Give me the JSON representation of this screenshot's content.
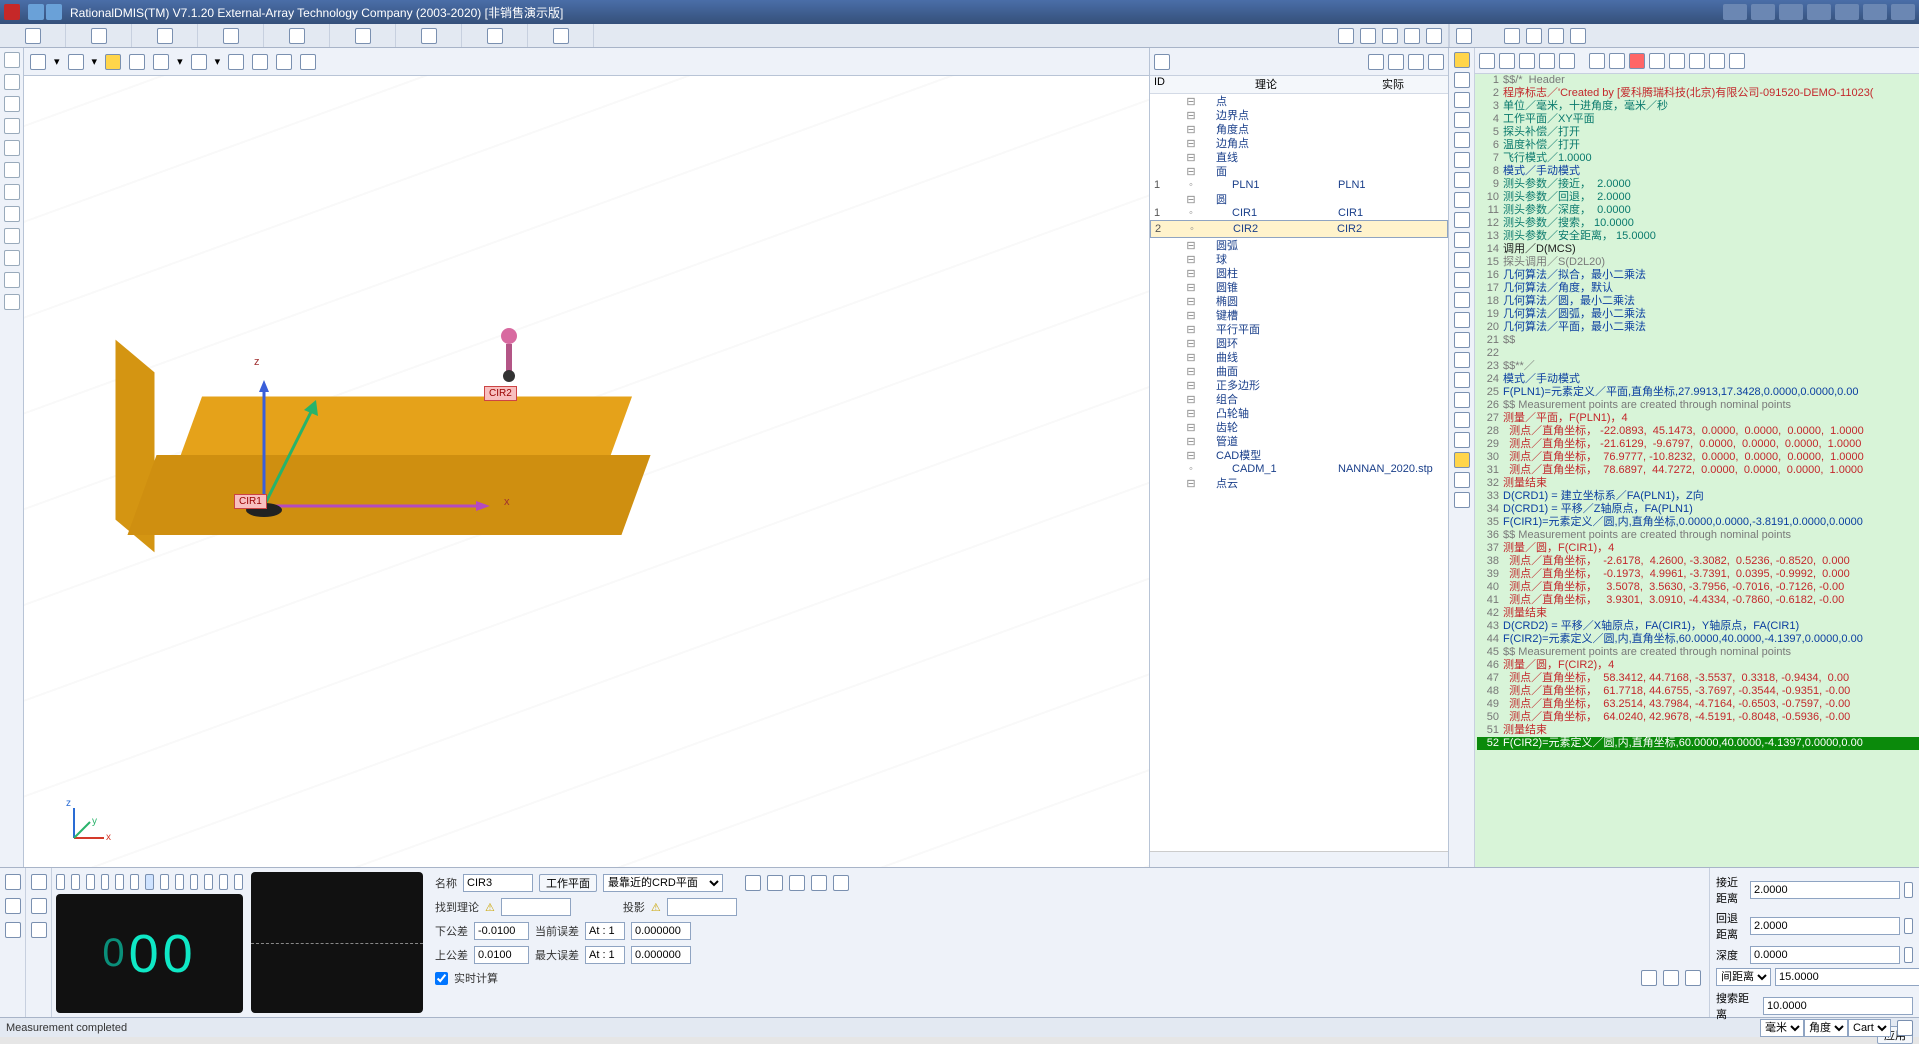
{
  "title": "RationalDMIS(TM) V7.1.20    External-Array Technology Company (2003-2020) [非销售演示版]",
  "ribbon_icons": [
    "open",
    "doc",
    "grid",
    "cube",
    "gem",
    "flask",
    "cloud",
    "gear",
    "window",
    "cube2",
    "shapes",
    "wrench",
    "target",
    "camera"
  ],
  "view_toolbar": [
    "home",
    "arrow",
    "refresh",
    "zoom",
    "axes",
    "eye",
    "layers",
    "print",
    "snapshot",
    "run"
  ],
  "view3d": {
    "x_axis": "x",
    "y_axis": "y",
    "z_axis": "z",
    "tag1": "CIR1",
    "tag2": "CIR2",
    "corner_x": "x",
    "corner_y": "y",
    "corner_z": "z"
  },
  "mid": {
    "col_id": "ID",
    "col_theory": "理论",
    "col_actual": "实际",
    "tree": [
      {
        "d": 1,
        "l": "点"
      },
      {
        "d": 1,
        "l": "边界点"
      },
      {
        "d": 1,
        "l": "角度点"
      },
      {
        "d": 1,
        "l": "边角点"
      },
      {
        "d": 1,
        "l": "直线"
      },
      {
        "d": 1,
        "l": "面"
      },
      {
        "d": 2,
        "id": "1",
        "l": "PLN1",
        "a": "PLN1"
      },
      {
        "d": 1,
        "l": "圆"
      },
      {
        "d": 2,
        "id": "1",
        "l": "CIR1",
        "a": "CIR1"
      },
      {
        "d": 2,
        "id": "2",
        "l": "CIR2",
        "a": "CIR2",
        "sel": true
      },
      {
        "d": 1,
        "l": "圆弧"
      },
      {
        "d": 1,
        "l": "球"
      },
      {
        "d": 1,
        "l": "圆柱"
      },
      {
        "d": 1,
        "l": "圆锥"
      },
      {
        "d": 1,
        "l": "椭圆"
      },
      {
        "d": 1,
        "l": "键槽"
      },
      {
        "d": 1,
        "l": "平行平面"
      },
      {
        "d": 1,
        "l": "圆环"
      },
      {
        "d": 1,
        "l": "曲线"
      },
      {
        "d": 1,
        "l": "曲面"
      },
      {
        "d": 1,
        "l": "正多边形"
      },
      {
        "d": 1,
        "l": "组合"
      },
      {
        "d": 1,
        "l": "凸轮轴"
      },
      {
        "d": 1,
        "l": "齿轮"
      },
      {
        "d": 1,
        "l": "管道"
      },
      {
        "d": 1,
        "l": "CAD模型"
      },
      {
        "d": 2,
        "l": "CADM_1",
        "a": "NANNAN_2020.stp"
      },
      {
        "d": 1,
        "l": "点云"
      }
    ]
  },
  "code": [
    {
      "n": 1,
      "t": "$$/*  Header",
      "c": "gray"
    },
    {
      "n": 2,
      "t": "程序标志／'Created by [爱科腾瑞科技(北京)有限公司-091520-DEMO-11023(",
      "c": "red"
    },
    {
      "n": 3,
      "t": "单位／毫米，十进角度，毫米／秒",
      "c": "teal"
    },
    {
      "n": 4,
      "t": "工作平面／XY平面",
      "c": "teal"
    },
    {
      "n": 5,
      "t": "探头补偿／打开",
      "c": "teal"
    },
    {
      "n": 6,
      "t": "温度补偿／打开",
      "c": "teal"
    },
    {
      "n": 7,
      "t": "飞行模式／1.0000",
      "c": "teal"
    },
    {
      "n": 8,
      "t": "模式／手动模式",
      "c": "blue"
    },
    {
      "n": 9,
      "t": "测头参数／接近，  2.0000",
      "c": "teal"
    },
    {
      "n": 10,
      "t": "测头参数／回退，  2.0000",
      "c": "teal"
    },
    {
      "n": 11,
      "t": "测头参数／深度，  0.0000",
      "c": "teal"
    },
    {
      "n": 12,
      "t": "测头参数／搜索， 10.0000",
      "c": "teal"
    },
    {
      "n": 13,
      "t": "测头参数／安全距离， 15.0000",
      "c": "teal"
    },
    {
      "n": 14,
      "t": "调用／D(MCS)",
      "c": "dk"
    },
    {
      "n": 15,
      "t": "探头调用／S(D2L20)",
      "c": "gray"
    },
    {
      "n": 16,
      "t": "几何算法／拟合，最小二乘法",
      "c": "blue"
    },
    {
      "n": 17,
      "t": "几何算法／角度，默认",
      "c": "blue"
    },
    {
      "n": 18,
      "t": "几何算法／圆，最小二乘法",
      "c": "blue"
    },
    {
      "n": 19,
      "t": "几何算法／圆弧，最小二乘法",
      "c": "blue"
    },
    {
      "n": 20,
      "t": "几何算法／平面，最小二乘法",
      "c": "blue"
    },
    {
      "n": 21,
      "t": "$$",
      "c": "gray"
    },
    {
      "n": 22,
      "t": "",
      "c": "gray"
    },
    {
      "n": 23,
      "t": "$$**／",
      "c": "gray"
    },
    {
      "n": 24,
      "t": "模式／手动模式",
      "c": "blue"
    },
    {
      "n": 25,
      "t": "F(PLN1)=元素定义／平面,直角坐标,27.9913,17.3428,0.0000,0.0000,0.00",
      "c": "blue"
    },
    {
      "n": 26,
      "t": "$$ Measurement points are created through nominal points",
      "c": "gray"
    },
    {
      "n": 27,
      "t": "测量／平面，F(PLN1)，4",
      "c": "red"
    },
    {
      "n": 28,
      "t": "  测点／直角坐标， -22.0893,  45.1473,  0.0000,  0.0000,  0.0000,  1.0000",
      "c": "red"
    },
    {
      "n": 29,
      "t": "  测点／直角坐标， -21.6129,  -9.6797,  0.0000,  0.0000,  0.0000,  1.0000",
      "c": "red"
    },
    {
      "n": 30,
      "t": "  测点／直角坐标，  76.9777, -10.8232,  0.0000,  0.0000,  0.0000,  1.0000",
      "c": "red"
    },
    {
      "n": 31,
      "t": "  测点／直角坐标，  78.6897,  44.7272,  0.0000,  0.0000,  0.0000,  1.0000",
      "c": "red"
    },
    {
      "n": 32,
      "t": "测量结束",
      "c": "red"
    },
    {
      "n": 33,
      "t": "D(CRD1) = 建立坐标系／FA(PLN1)，Z向",
      "c": "blue"
    },
    {
      "n": 34,
      "t": "D(CRD1) = 平移／Z轴原点，FA(PLN1)",
      "c": "blue"
    },
    {
      "n": 35,
      "t": "F(CIR1)=元素定义／圆,内,直角坐标,0.0000,0.0000,-3.8191,0.0000,0.0000",
      "c": "blue"
    },
    {
      "n": 36,
      "t": "$$ Measurement points are created through nominal points",
      "c": "gray"
    },
    {
      "n": 37,
      "t": "测量／圆，F(CIR1)，4",
      "c": "red"
    },
    {
      "n": 38,
      "t": "  测点／直角坐标，  -2.6178,  4.2600, -3.3082,  0.5236, -0.8520,  0.000",
      "c": "red"
    },
    {
      "n": 39,
      "t": "  测点／直角坐标，  -0.1973,  4.9961, -3.7391,  0.0395, -0.9992,  0.000",
      "c": "red"
    },
    {
      "n": 40,
      "t": "  测点／直角坐标，   3.5078,  3.5630, -3.7956, -0.7016, -0.7126, -0.00",
      "c": "red"
    },
    {
      "n": 41,
      "t": "  测点／直角坐标，   3.9301,  3.0910, -4.4334, -0.7860, -0.6182, -0.00",
      "c": "red"
    },
    {
      "n": 42,
      "t": "测量结束",
      "c": "red"
    },
    {
      "n": 43,
      "t": "D(CRD2) = 平移／X轴原点，FA(CIR1)，Y轴原点，FA(CIR1)",
      "c": "blue"
    },
    {
      "n": 44,
      "t": "F(CIR2)=元素定义／圆,内,直角坐标,60.0000,40.0000,-4.1397,0.0000,0.00",
      "c": "blue"
    },
    {
      "n": 45,
      "t": "$$ Measurement points are created through nominal points",
      "c": "gray"
    },
    {
      "n": 46,
      "t": "测量／圆，F(CIR2)，4",
      "c": "red"
    },
    {
      "n": 47,
      "t": "  测点／直角坐标，  58.3412, 44.7168, -3.5537,  0.3318, -0.9434,  0.00",
      "c": "red"
    },
    {
      "n": 48,
      "t": "  测点／直角坐标，  61.7718, 44.6755, -3.7697, -0.3544, -0.9351, -0.00",
      "c": "red"
    },
    {
      "n": 49,
      "t": "  测点／直角坐标，  63.2514, 43.7984, -4.7164, -0.6503, -0.7597, -0.00",
      "c": "red"
    },
    {
      "n": 50,
      "t": "  测点／直角坐标，  64.0240, 42.9678, -4.5191, -0.8048, -0.5936, -0.00",
      "c": "red"
    },
    {
      "n": 51,
      "t": "测量结束",
      "c": "red"
    },
    {
      "n": 52,
      "t": "F(CIR2)=元素定义／圆,内,直角坐标,60.0000,40.0000,-4.1397,0.0000,0.00",
      "c": "hl"
    }
  ],
  "bottom": {
    "counter": "000",
    "name_label": "名称",
    "name_value": "CIR3",
    "workplane_btn": "工作平面",
    "crd_select": "最靠近的CRD平面",
    "found_label": "找到理论",
    "found_value": "",
    "proj_label": "投影",
    "proj_value": "",
    "lowtol_label": "下公差",
    "lowtol_value": "-0.0100",
    "uptol_label": "上公差",
    "uptol_value": "0.0100",
    "curerr_label": "当前误差",
    "curerr_at": "At : 1",
    "curerr_value": "0.000000",
    "maxerr_label": "最大误差",
    "maxerr_at": "At : 1",
    "maxerr_value": "0.000000",
    "realtime_label": "实时计算",
    "approach_label": "接近距离",
    "approach_value": "2.0000",
    "retract_label": "回退距离",
    "retract_value": "2.0000",
    "depth_label": "深度",
    "depth_value": "0.0000",
    "spacing_select": "间距离",
    "spacing_value": "15.0000",
    "search_label": "搜索距离",
    "search_value": "10.0000",
    "apply_btn": "应用"
  },
  "status": {
    "msg": "Measurement completed",
    "unit1": "毫米",
    "unit2": "角度",
    "unit3": "Cart"
  }
}
